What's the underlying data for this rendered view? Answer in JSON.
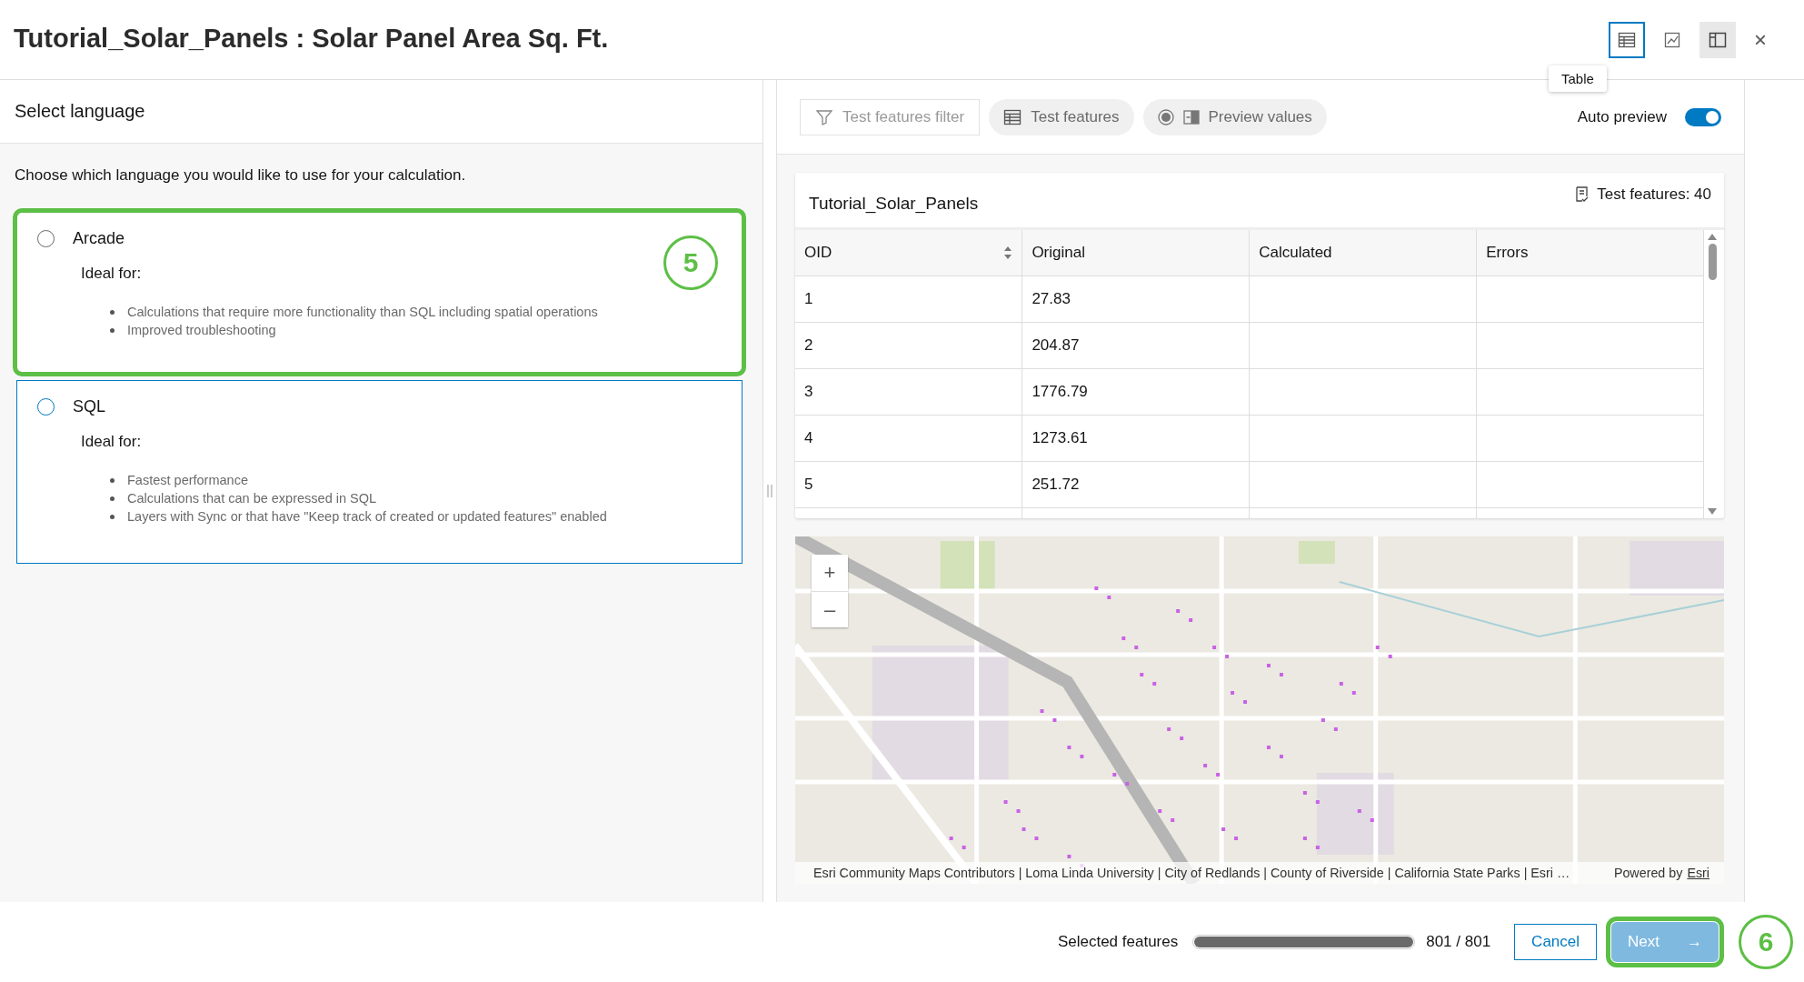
{
  "window": {
    "title": "Tutorial_Solar_Panels : Solar Panel Area Sq. Ft.",
    "close": "×"
  },
  "view_buttons": [
    {
      "kind": "table",
      "selected": true,
      "pressed": false
    },
    {
      "kind": "chart",
      "selected": false,
      "pressed": false
    },
    {
      "kind": "panel",
      "selected": false,
      "pressed": true
    }
  ],
  "tooltip": "Table",
  "left_panel": {
    "heading": "Select language",
    "intro": "Choose which language you would like to use for your calculation.",
    "options": [
      {
        "name": "Arcade",
        "subtitle": "Ideal for:",
        "selected": false,
        "focused": false,
        "callout": "5",
        "bullets": [
          "Calculations that require more functionality than SQL including spatial operations",
          "Improved troubleshooting"
        ]
      },
      {
        "name": "SQL",
        "subtitle": "Ideal for:",
        "selected": false,
        "focused": true,
        "bullets": [
          "Fastest performance",
          "Calculations that can be expressed in SQL",
          "Layers with Sync or that have \"Keep track of created or updated features\" enabled"
        ]
      }
    ]
  },
  "toolbar": {
    "buttons": [
      {
        "kind": "filter",
        "label": "Test features filter",
        "disabled": true
      },
      {
        "kind": "table",
        "label": "Test features",
        "disabled": false
      },
      {
        "kind": "preview",
        "label": "Preview values",
        "disabled": false
      }
    ],
    "auto_preview": {
      "label": "Auto preview",
      "on": true
    }
  },
  "table": {
    "title": "Tutorial_Solar_Panels",
    "count": "Test features: 40",
    "columns": [
      {
        "label": "OID",
        "sortable": true
      },
      {
        "label": "Original",
        "sortable": false
      },
      {
        "label": "Calculated",
        "sortable": false
      },
      {
        "label": "Errors",
        "sortable": false
      }
    ],
    "rows": [
      [
        "1",
        "27.83"
      ],
      [
        "2",
        "204.87"
      ],
      [
        "3",
        "1776.79"
      ],
      [
        "4",
        "1273.61"
      ],
      [
        "5",
        "251.72"
      ]
    ]
  },
  "map": {
    "kind": "picture",
    "zoom_in": "+",
    "zoom_out": "–",
    "attribution": "Esri Community Maps Contributors | Loma Linda University | City of Redlands | County of Riverside | California State Parks | Esri …",
    "powered": "Powered by",
    "powered_link": "Esri"
  },
  "footer": {
    "label": "Selected features",
    "level": 1,
    "count": "801 / 801",
    "cancel": "Cancel",
    "next": "Next",
    "next_arrow": "→",
    "next_highlighted": true,
    "callout": "6"
  }
}
